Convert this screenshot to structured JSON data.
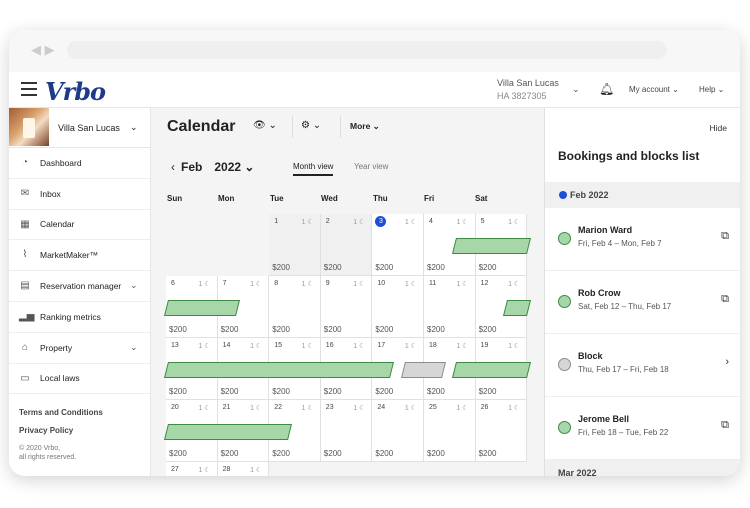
{
  "topbar": {
    "logo": "Vrbo",
    "property_name": "Villa San Lucas",
    "property_code": "HA 3827305",
    "my_account": "My account",
    "help": "Help"
  },
  "sidebar": {
    "property": "Villa San Lucas",
    "items": [
      {
        "label": "Dashboard",
        "icon": "dashboard-icon"
      },
      {
        "label": "Inbox",
        "icon": "mail-icon"
      },
      {
        "label": "Calendar",
        "icon": "calendar-icon"
      },
      {
        "label": "MarketMaker™",
        "icon": "chart-icon"
      },
      {
        "label": "Reservation manager",
        "icon": "reservation-icon"
      },
      {
        "label": "Ranking metrics",
        "icon": "bar-chart-icon"
      },
      {
        "label": "Property",
        "icon": "home-icon"
      },
      {
        "label": "Local laws",
        "icon": "document-icon"
      }
    ],
    "terms": "Terms and Conditions",
    "privacy": "Privacy Policy",
    "copyright_1": "© 2020 Vrbo,",
    "copyright_2": "all rights reserved."
  },
  "calendar": {
    "title": "Calendar",
    "more": "More",
    "month": "Feb",
    "year": "2022",
    "month_view": "Month view",
    "year_view": "Year view",
    "weekdays": [
      "Sun",
      "Mon",
      "Tue",
      "Wed",
      "Thu",
      "Fri",
      "Sat"
    ],
    "nights": "1",
    "price": "$200",
    "today": 3
  },
  "panel": {
    "hide": "Hide",
    "title": "Bookings and blocks list",
    "month_feb": "Feb 2022",
    "month_mar": "Mar 2022",
    "bookings": [
      {
        "name": "Marion Ward",
        "dates": "Fri, Feb 4 – Mon, Feb 7",
        "type": "booking"
      },
      {
        "name": "Rob Crow",
        "dates": "Sat, Feb 12 – Thu, Feb 17",
        "type": "booking"
      },
      {
        "name": "Block",
        "dates": "Thu, Feb 17 – Fri, Feb 18",
        "type": "block"
      },
      {
        "name": "Jerome Bell",
        "dates": "Fri, Feb 18 – Tue, Feb 22",
        "type": "booking"
      }
    ]
  }
}
